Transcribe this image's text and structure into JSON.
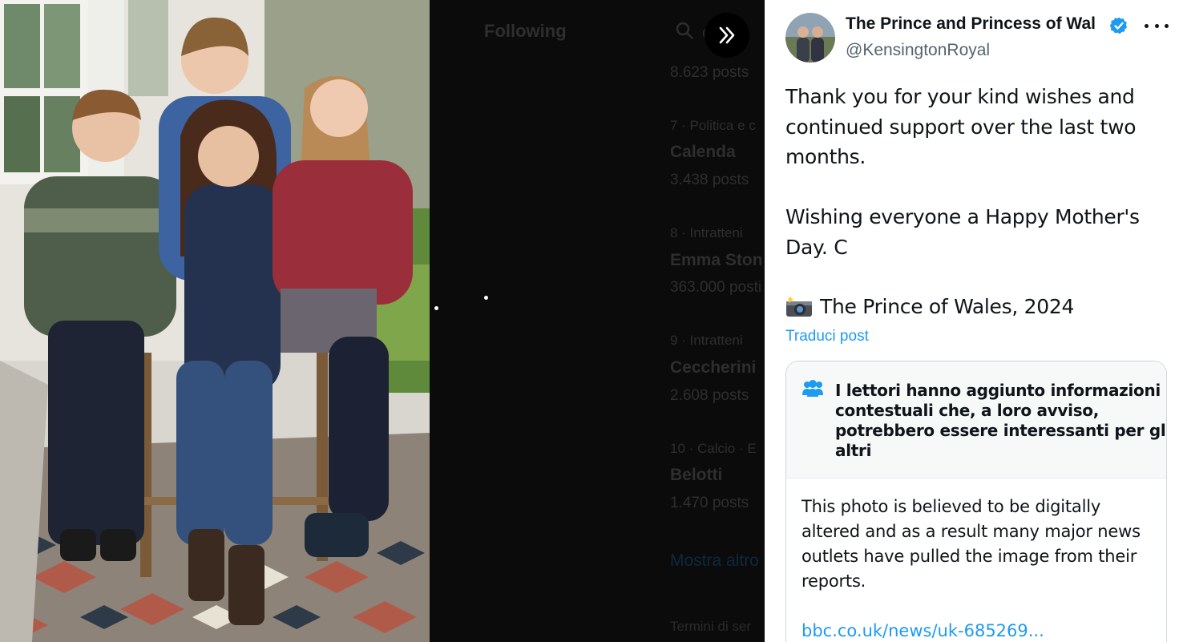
{
  "background": {
    "title": "Following",
    "search_text": "ca",
    "rows": [
      {
        "count": "8.623 posts"
      },
      {
        "meta": "7 · Politica e c",
        "name": "Calenda",
        "count": "3.438 posts"
      },
      {
        "meta": "8 · Intratteni",
        "name": "Emma Ston",
        "count": "363.000 posti"
      },
      {
        "meta": "9 · Intratteni",
        "name": "Ceccherini",
        "count": "2.608 posts"
      },
      {
        "meta": "10 · Calcio · E",
        "name": "Belotti",
        "count": "1.470 posts"
      }
    ],
    "show_more": "Mostra altro",
    "footer": "Termini di ser"
  },
  "post": {
    "author": "The Prince and Princess of Wal",
    "handle": "@KensingtonRoyal",
    "body_lines": [
      "Thank you for your kind wishes and",
      "continued support over the last two",
      "months.",
      "Wishing everyone a Happy Mother's",
      "Day. C",
      "The Prince of Wales, 2024"
    ],
    "translate": "Traduci post"
  },
  "note": {
    "title_lines": [
      "I lettori hanno aggiunto informazioni",
      "contestuali che, a loro avviso,",
      "potrebbero essere interessanti per gli",
      "altri"
    ],
    "body_lines": [
      "This photo is believed to be digitally",
      "altered and as a result many major news",
      "outlets have pulled the image from their",
      "reports."
    ],
    "link": "bbc.co.uk/news/uk-685269..."
  },
  "colors": {
    "accent": "#1d9bf0",
    "text": "#0f1419",
    "muted": "#536471"
  },
  "icons": {
    "expand": "double-chevron-right-icon",
    "more": "more-horizontal-icon",
    "verified": "verified-badge-icon",
    "camera": "camera-flash-icon",
    "note": "people-icon",
    "search": "search-icon"
  }
}
